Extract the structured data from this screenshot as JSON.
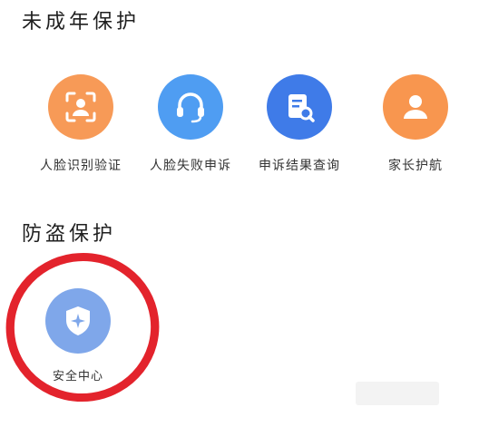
{
  "sections": {
    "minor": {
      "title": "未成年保护",
      "items": [
        {
          "label": "人脸识别验证",
          "icon": "face-scan-icon",
          "color": "#f79a57"
        },
        {
          "label": "人脸失败申诉",
          "icon": "headset-icon",
          "color": "#4f9df2"
        },
        {
          "label": "申诉结果查询",
          "icon": "document-search-icon",
          "color": "#3f7be8"
        },
        {
          "label": "家长护航",
          "icon": "user-icon",
          "color": "#f8964f"
        }
      ]
    },
    "theft": {
      "title": "防盗保护",
      "items": [
        {
          "label": "安全中心",
          "icon": "shield-icon",
          "color": "#7fa7ea"
        }
      ]
    }
  },
  "annotation": {
    "color": "#e3232c"
  }
}
